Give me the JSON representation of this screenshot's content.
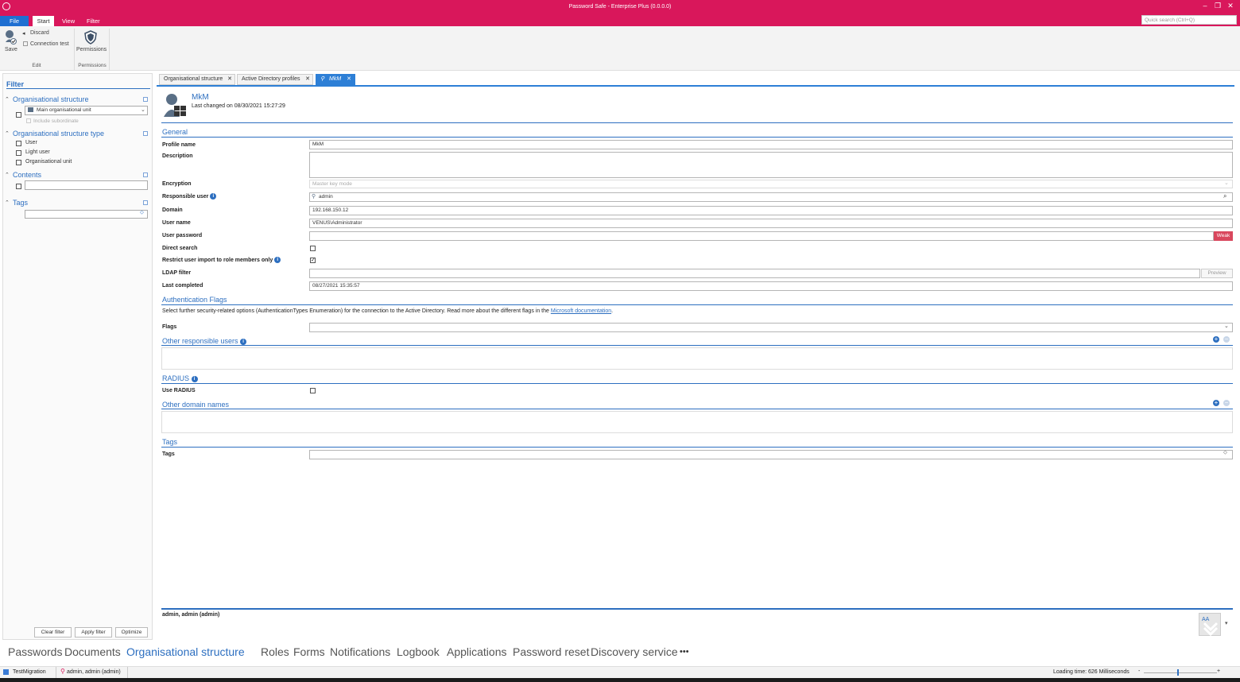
{
  "window": {
    "title": "Password Safe - Enterprise Plus (0.0.0.0)",
    "min": "–",
    "restore": "❐",
    "close": "✕"
  },
  "ribbon_tabs": [
    "File",
    "Start",
    "View",
    "Filter"
  ],
  "quick_search": {
    "placeholder": "Quick search (Ctrl+Q)"
  },
  "ribbon": {
    "save": "Save",
    "discard": "Discard",
    "connection_test": "Connection test",
    "permissions": "Permissions",
    "group_edit": "Edit",
    "group_permissions": "Permissions"
  },
  "filter": {
    "title": "Filter",
    "org_structure": {
      "title": "Organisational structure",
      "value": "Main organisational unit",
      "include_subordinate": "Include subordinate"
    },
    "org_type": {
      "title": "Organisational structure type",
      "options": [
        "User",
        "Light user",
        "Organisational unit"
      ]
    },
    "contents": {
      "title": "Contents",
      "value": ""
    },
    "tags": {
      "title": "Tags",
      "value": ""
    },
    "buttons": {
      "clear": "Clear filter",
      "apply": "Apply filter",
      "optimize": "Optimize"
    }
  },
  "doc_tabs": [
    "Organisational structure",
    "Active Directory profiles",
    "MkM"
  ],
  "record": {
    "name": "MkM",
    "last_changed": "Last changed on 08/30/2021 15:27:29"
  },
  "general": {
    "title": "General",
    "profile_name_label": "Profile name",
    "profile_name": "MkM",
    "description_label": "Description",
    "description": "",
    "encryption_label": "Encryption",
    "encryption": "Master key mode",
    "responsible_label": "Responsible user",
    "responsible": "admin",
    "domain_label": "Domain",
    "domain": "192.168.150.12",
    "username_label": "User name",
    "username": "VENUS\\Administrator",
    "password_label": "User password",
    "password_strength": "Weak",
    "direct_search_label": "Direct search",
    "direct_search": false,
    "restrict_label": "Restrict user import to role members only",
    "restrict": true,
    "ldap_label": "LDAP filter",
    "ldap": "",
    "preview": "Preview",
    "last_completed_label": "Last completed",
    "last_completed": "08/27/2021 15:35:57"
  },
  "auth_flags": {
    "title": "Authentication Flags",
    "desc": "Select further security-related options (AuthenticationTypes Enumeration) for the connection to the Active Directory. Read more about the different flags in the",
    "link": "Microsoft documentation",
    "flags_label": "Flags",
    "flags": ""
  },
  "other_responsible": {
    "title": "Other responsible users"
  },
  "radius": {
    "title": "RADIUS",
    "use_label": "Use RADIUS",
    "use": false
  },
  "other_domains": {
    "title": "Other domain names"
  },
  "tags_section": {
    "title": "Tags",
    "label": "Tags",
    "value": ""
  },
  "footer_user": "admin, admin (admin)",
  "bottom_nav": [
    "Passwords",
    "Documents",
    "Organisational structure",
    "Roles",
    "Forms",
    "Notifications",
    "Logbook",
    "Applications",
    "Password reset",
    "Discovery service",
    "•••"
  ],
  "status": {
    "db": "TestMigration",
    "user": "admin, admin (admin)",
    "loading": "Loading time: 626 Milliseconds",
    "zoom_minus": "-",
    "zoom_plus": "+"
  },
  "colors": {
    "accent": "#d9175b",
    "blue": "#2d6fc0",
    "weak": "#d9475d"
  }
}
